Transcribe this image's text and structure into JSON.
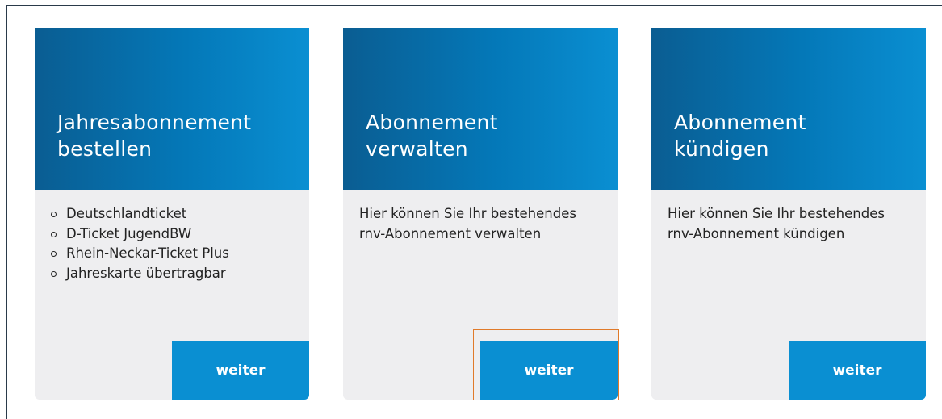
{
  "cards": [
    {
      "title_line1": "Jahresabonnement",
      "title_line2": "bestellen",
      "items": [
        "Deutschlandticket",
        "D-Ticket JugendBW",
        "Rhein-Neckar-Ticket Plus",
        "Jahreskarte übertragbar"
      ],
      "button_label": "weiter"
    },
    {
      "title_line1": "Abonnement",
      "title_line2": "verwalten",
      "desc_line1": "Hier können Sie Ihr bestehendes",
      "desc_line2": "rnv-Abonnement verwalten",
      "button_label": "weiter"
    },
    {
      "title_line1": "Abonnement",
      "title_line2": "kündigen",
      "desc_line1": "Hier können Sie Ihr bestehendes",
      "desc_line2": "rnv-Abonnement kündigen",
      "button_label": "weiter"
    }
  ],
  "colors": {
    "header_dark": "#0a5d92",
    "header_light": "#0a8fd2",
    "button": "#0a8fd2",
    "card_bg": "#eeeef0",
    "focus_outline": "#e07a2a"
  }
}
